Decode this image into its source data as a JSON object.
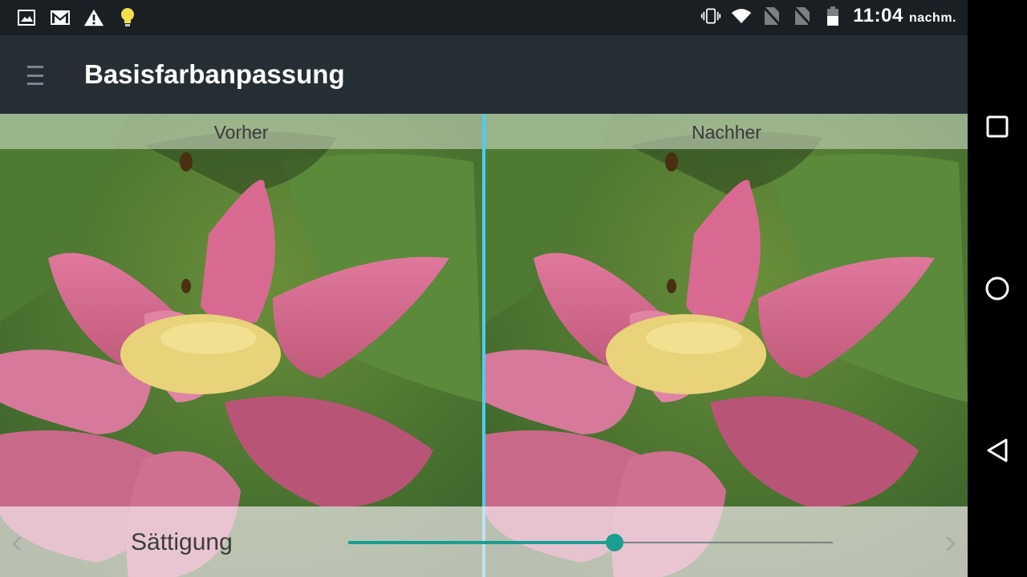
{
  "status_bar": {
    "icons_left": [
      "image-icon",
      "gmail-icon",
      "warning-icon",
      "lightbulb-icon"
    ],
    "icons_right": [
      "vibrate-icon",
      "wifi-icon",
      "no-sim-icon",
      "no-sim-icon",
      "battery-icon"
    ],
    "time": "11:04",
    "ampm": "nachm."
  },
  "toolbar": {
    "menu_icon": "hamburger-menu-icon",
    "title": "Basisfarbanpassung"
  },
  "comparison": {
    "before_label": "Vorher",
    "after_label": "Nachher",
    "divider_color": "#4ecdf0"
  },
  "control": {
    "label": "Sättigung",
    "prev_glyph": "‹",
    "next_glyph": "›",
    "slider_value": 0.55,
    "accent": "#1a9e92"
  },
  "nav_bar": {
    "buttons": [
      "recents-square-icon",
      "home-circle-icon",
      "back-triangle-icon"
    ]
  }
}
